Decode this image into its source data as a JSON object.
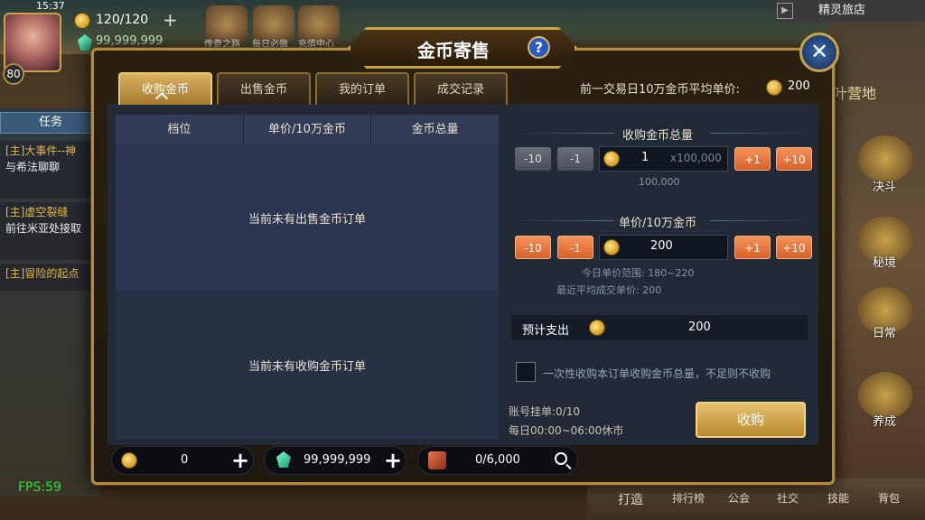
{
  "hud": {
    "time": "15:37",
    "level": "80",
    "stamina": "120/120",
    "diamonds": "99,999,999",
    "top_icons": [
      "传奇之路",
      "每日必做",
      "充值中心"
    ],
    "task_label": "任务",
    "quests": [
      {
        "prefix": "[主]大事件--神",
        "body": "与希法聊聊"
      },
      {
        "prefix": "[主]虚空裂缝",
        "body": "前往米亚处接取"
      },
      {
        "prefix": "[主]冒险的起点",
        "body": ""
      }
    ],
    "fps": "FPS:59",
    "right_panel_title": "精灵旅店",
    "camp_label": "叶营地",
    "side_labels": [
      "决斗",
      "秘境",
      "日常",
      "养成"
    ],
    "bottom_labels": [
      "打造",
      "排行榜",
      "公会",
      "社交",
      "技能",
      "背包"
    ]
  },
  "modal": {
    "title": "金币寄售",
    "help": "?",
    "close": "✕",
    "tabs": [
      "收购金币",
      "出售金币",
      "我的订单",
      "成交记录"
    ],
    "active_tab": 0,
    "avg_label": "前一交易日10万金币平均单价:",
    "avg_value": "200",
    "table_headers": [
      "档位",
      "单价/10万金币",
      "金币总量"
    ],
    "empty_sell": "当前未有出售金币订单",
    "empty_buy": "当前未有收购金币订单",
    "total_section": {
      "title": "收购金币总量",
      "minus10": "-10",
      "minus1": "-1",
      "value": "1",
      "unit": "x100,000",
      "plus1": "+1",
      "plus10": "+10",
      "hint": "100,000"
    },
    "price_section": {
      "title": "单价/10万金币",
      "minus10": "-10",
      "minus1": "-1",
      "value": "200",
      "plus1": "+1",
      "plus10": "+10",
      "range_hint": "今日单价范围: 180~220",
      "avg_hint": "最近平均成交单价: 200"
    },
    "spend_label": "预计支出",
    "spend_value": "200",
    "checkbox_label": "一次性收购本订单收购金币总量，不足则不收购",
    "account_orders": "账号挂单:0/10",
    "closed_hours": "每日00:00~06:00休市",
    "buy_button": "收购",
    "currencies": {
      "gold": "0",
      "gems": "99,999,999",
      "tickets": "0/6,000"
    }
  }
}
